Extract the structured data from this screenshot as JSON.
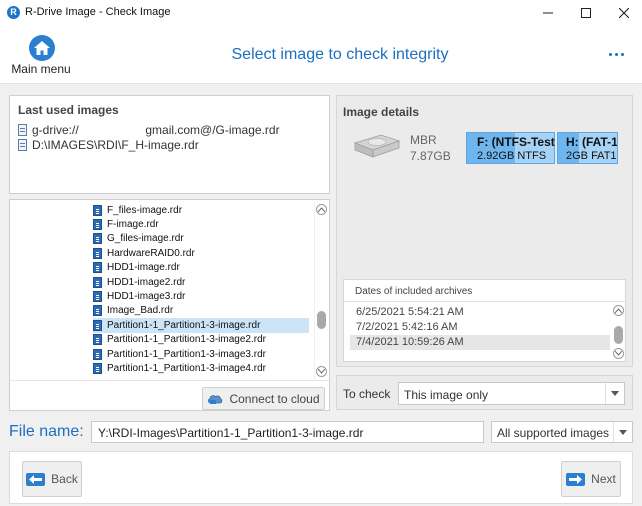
{
  "window": {
    "title": "R-Drive Image - Check Image",
    "app_icon_letter": "R"
  },
  "header": {
    "home_label": "Main menu",
    "title": "Select image to check integrity"
  },
  "recent": {
    "title": "Last used images",
    "items": [
      "g-drive://                    gmail.com@/G-image.rdr",
      "D:\\IMAGES\\RDI\\F_H-image.rdr"
    ]
  },
  "file_tree": {
    "items": [
      "F_files-image.rdr",
      "F-image.rdr",
      "G_files-image.rdr",
      "HardwareRAID0.rdr",
      "HDD1-image.rdr",
      "HDD1-image2.rdr",
      "HDD1-image3.rdr",
      "Image_Bad.rdr",
      "Partition1-1_Partition1-3-image.rdr",
      "Partition1-1_Partition1-3-image2.rdr",
      "Partition1-1_Partition1-3-image3.rdr",
      "Partition1-1_Partition1-3-image4.rdr"
    ],
    "selected_index": 8,
    "connect_label": "Connect to cloud"
  },
  "details": {
    "title": "Image details",
    "disk_scheme": "MBR",
    "disk_size": "7.87GB",
    "partitions": [
      {
        "name": "F: (NTFS-Test",
        "info": "2.92GB NTFS"
      },
      {
        "name": "H: (FAT-1",
        "info": "2GB FAT1"
      }
    ],
    "archives_header": "Dates of included archives",
    "archives": [
      "6/25/2021 5:54:21 AM",
      "7/2/2021 5:42:16 AM",
      "7/4/2021 10:59:26 AM"
    ],
    "selected_archive_index": 2
  },
  "to_check": {
    "label": "To check",
    "value": "This image only"
  },
  "file_name": {
    "label": "File name:",
    "value": "Y:\\RDI-Images\\Partition1-1_Partition1-3-image.rdr",
    "filter": "All supported images"
  },
  "footer": {
    "back_label": "Back",
    "next_label": "Next"
  },
  "colors": {
    "accent": "#1b6fc1",
    "partition_fill": "#a6d2f5",
    "selection": "#cce4f7"
  }
}
